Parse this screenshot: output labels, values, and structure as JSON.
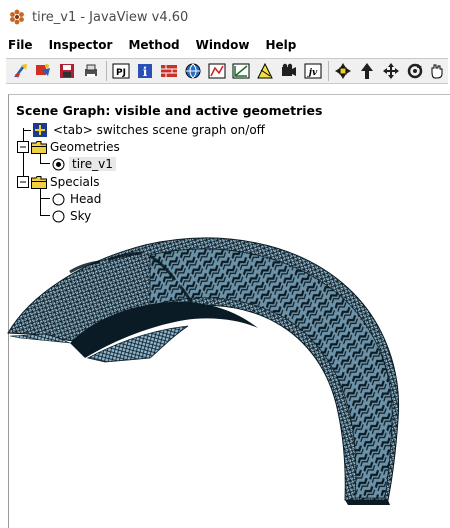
{
  "window": {
    "title": "tire_v1 - JavaView v4.60",
    "icon": "javaview-logo-icon"
  },
  "menubar": {
    "items": [
      "File",
      "Inspector",
      "Method",
      "Window",
      "Help"
    ]
  },
  "toolbar": {
    "buttons": [
      "pick-icon",
      "pick-vertex-icon",
      "save-icon",
      "print-icon",
      "pj-icon",
      "info-icon",
      "brick-icon",
      "globe-icon",
      "chart-icon",
      "camera-view-icon",
      "triangle-icon",
      "film-icon",
      "jv-icon",
      "scale-icon",
      "translate-icon",
      "move-icon",
      "rotate-icon",
      "hand-icon"
    ],
    "labels": {
      "pj": "PJ",
      "info": "i",
      "jv": "jv"
    }
  },
  "scene_graph": {
    "title": "Scene Graph: visible and active geometries",
    "hint": "<tab> switches scene graph on/off",
    "groups": [
      {
        "label": "Geometries",
        "items": [
          {
            "label": "tire_v1",
            "selected": true
          }
        ]
      },
      {
        "label": "Specials",
        "items": [
          {
            "label": "Head",
            "selected": false
          },
          {
            "label": "Sky",
            "selected": false
          }
        ]
      }
    ]
  },
  "viewport": {
    "model": "tire_v1",
    "mesh_color": "#a8c8d8",
    "wire_color": "#0a1a24"
  }
}
